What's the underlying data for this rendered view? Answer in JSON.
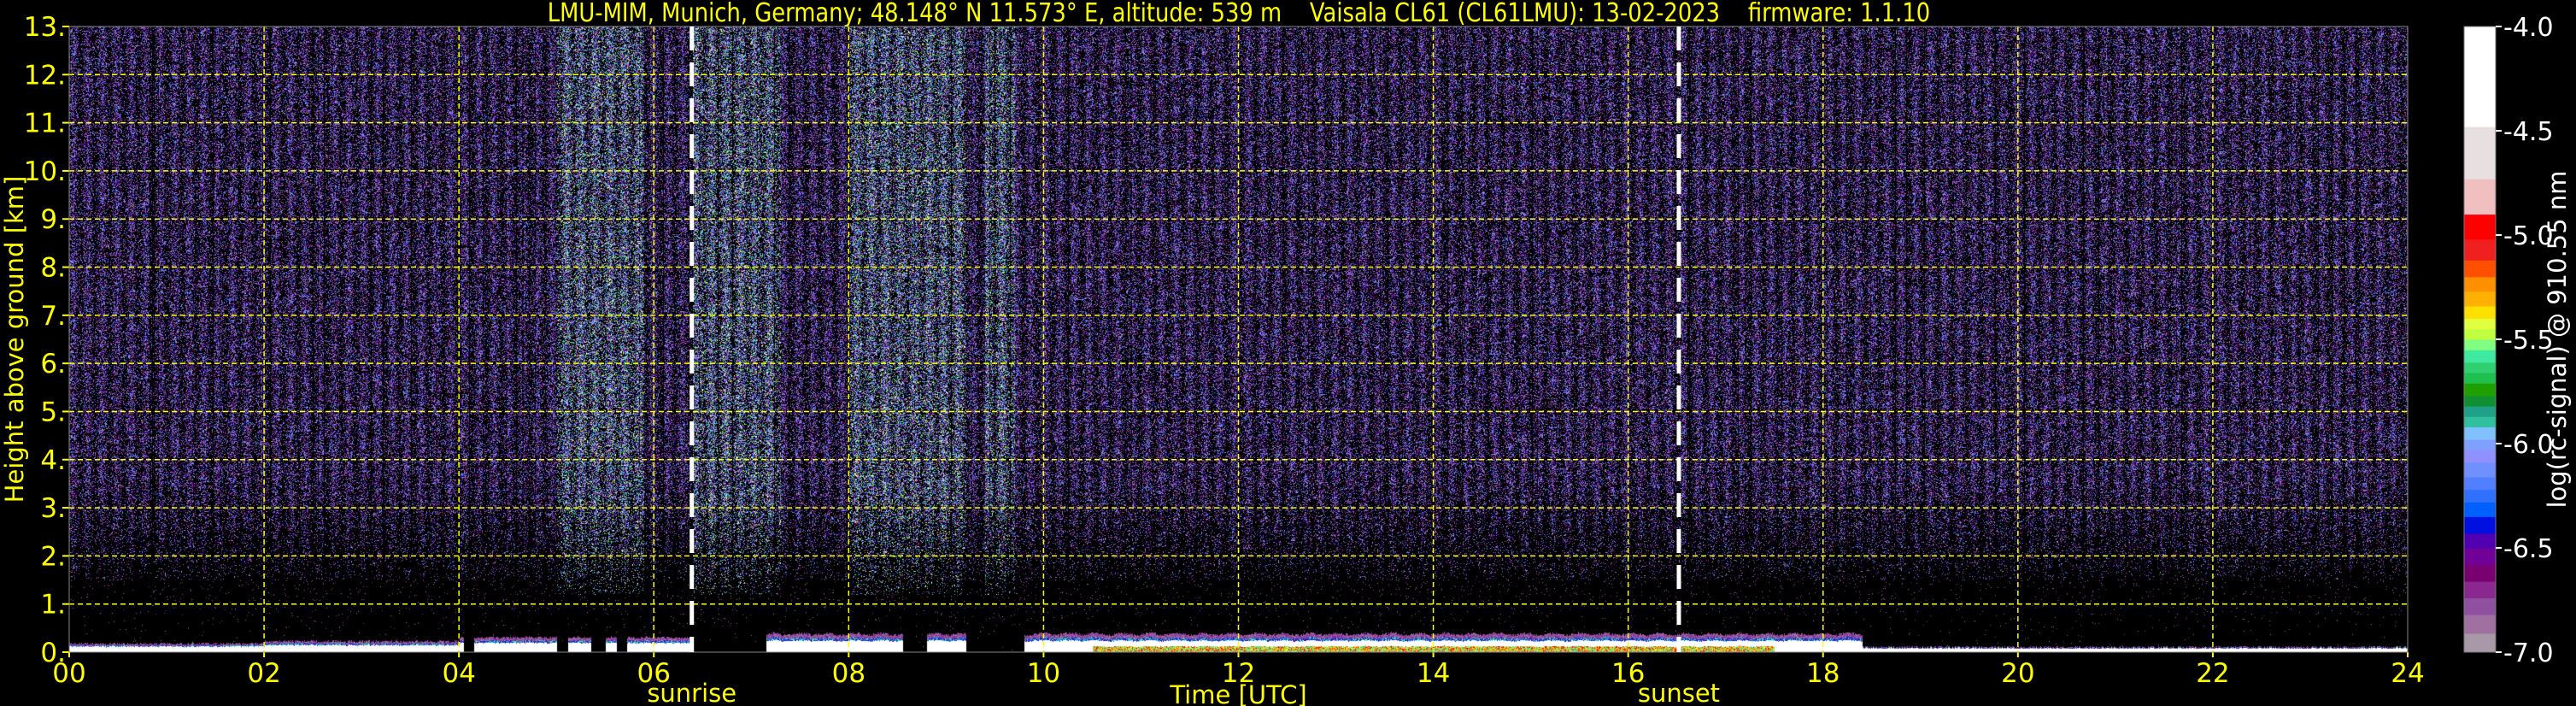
{
  "chart_data": {
    "type": "heatmap",
    "title": "LMU-MIM, Munich, Germany; 48.148° N 11.573° E, altitude: 539 m    Vaisala CL61 (CL61LMU): 13-02-2023    firmware: 1.1.10",
    "xlabel": "Time [UTC]",
    "ylabel": "Height above ground [km]",
    "xlim": [
      0,
      24
    ],
    "ylim": [
      0,
      13
    ],
    "x_ticks": [
      0,
      2,
      4,
      6,
      8,
      10,
      12,
      14,
      16,
      18,
      20,
      22,
      24
    ],
    "x_tick_labels": [
      "00",
      "02",
      "04",
      "06",
      "08",
      "10",
      "12",
      "14",
      "16",
      "18",
      "20",
      "22",
      "24"
    ],
    "y_ticks": [
      0,
      1,
      2,
      3,
      4,
      5,
      6,
      7,
      8,
      9,
      10,
      11,
      12,
      13
    ],
    "y_tick_labels": [
      "0.",
      "1.",
      "2.",
      "3.",
      "4.",
      "5.",
      "6.",
      "7.",
      "8.",
      "9.",
      "10.",
      "11.",
      "12.",
      "13."
    ],
    "grid": true,
    "markers": [
      {
        "label": "sunrise",
        "time_utc": 6.39
      },
      {
        "label": "sunset",
        "time_utc": 16.52
      }
    ],
    "data_gaps_utc": [
      [
        4.05,
        4.15
      ],
      [
        5.0,
        5.12
      ],
      [
        5.35,
        5.5
      ],
      [
        5.62,
        5.72
      ],
      [
        6.4,
        7.15
      ],
      [
        8.55,
        8.8
      ],
      [
        9.2,
        9.8
      ]
    ],
    "boundary_layer_top_km": {
      "night": 0.15,
      "morning": 0.3,
      "day": 0.35,
      "evening": 0.1
    },
    "colorbar": {
      "label": "log(rc-signal) @ 910.55 nm",
      "range": [
        -7.0,
        -4.0
      ],
      "tick_values": [
        -4.0,
        -4.5,
        -5.0,
        -5.5,
        -6.0,
        -6.5,
        -7.0
      ],
      "tick_labels": [
        "-4.0",
        "-4.5",
        "-5.0",
        "-5.5",
        "-6.0",
        "-6.5",
        "-7.0"
      ],
      "boundaries": [
        -7.0,
        -6.91,
        -6.82,
        -6.74,
        -6.66,
        -6.58,
        -6.5,
        -6.43,
        -6.35,
        -6.28,
        -6.22,
        -6.16,
        -6.09,
        -6.03,
        -5.98,
        -5.92,
        -5.87,
        -5.82,
        -5.77,
        -5.71,
        -5.66,
        -5.61,
        -5.55,
        -5.5,
        -5.45,
        -5.4,
        -5.34,
        -5.27,
        -5.2,
        -5.12,
        -5.02,
        -4.9,
        -4.73,
        -4.48,
        -4.0
      ],
      "colors": [
        "#a898a8",
        "#a070a0",
        "#9050a0",
        "#8a2890",
        "#780070",
        "#700098",
        "#5000b0",
        "#0010e0",
        "#0060ff",
        "#3070ff",
        "#5080ff",
        "#7090ff",
        "#9090ff",
        "#80a0ff",
        "#80c0ff",
        "#30c0a0",
        "#20a088",
        "#109030",
        "#20a000",
        "#20c050",
        "#30d070",
        "#40e8a0",
        "#80ff80",
        "#c0ff40",
        "#e0ff40",
        "#ffe000",
        "#ffb000",
        "#ff9000",
        "#ff5000",
        "#f02020",
        "#ff0000",
        "#f0c0c0",
        "#e8e0e0",
        "#ffffff"
      ]
    },
    "colors": {
      "axis_text": "#ffff00",
      "grid": "#ffff00",
      "marker_line": "#ffffff",
      "colorbar_text": "#ffffff",
      "background": "#000000"
    }
  }
}
